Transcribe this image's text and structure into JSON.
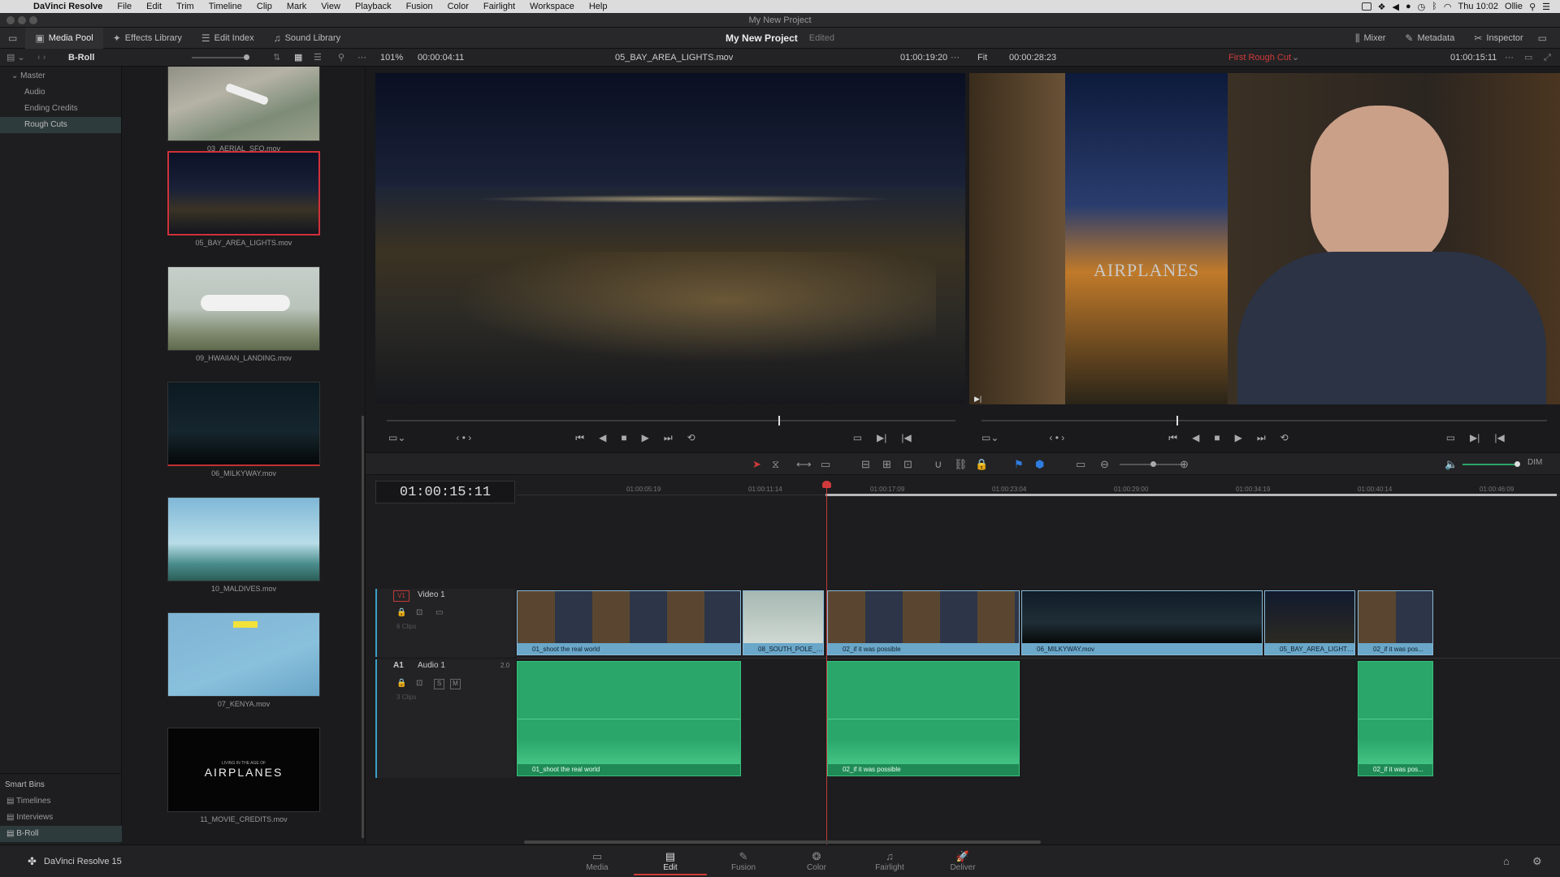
{
  "menubar": {
    "app": "DaVinci Resolve",
    "items": [
      "File",
      "Edit",
      "Trim",
      "Timeline",
      "Clip",
      "Mark",
      "View",
      "Playback",
      "Fusion",
      "Color",
      "Fairlight",
      "Workspace",
      "Help"
    ],
    "clock": "Thu 10:02",
    "user": "Ollie"
  },
  "window_title": "My New Project",
  "toolbar": {
    "media_pool": "Media Pool",
    "effects_library": "Effects Library",
    "edit_index": "Edit Index",
    "sound_library": "Sound Library",
    "project_name": "My New Project",
    "project_status": "Edited",
    "mixer": "Mixer",
    "metadata": "Metadata",
    "inspector": "Inspector"
  },
  "subbar": {
    "bin": "B-Roll",
    "src_zoom": "101%",
    "src_duration": "00:00:04:11",
    "src_clip": "05_BAY_AREA_LIGHTS.mov",
    "src_timecode": "01:00:19:20",
    "prg_zoom": "Fit",
    "prg_duration": "00:00:28:23",
    "timeline_name": "First Rough Cut",
    "prg_timecode": "01:00:15:11"
  },
  "bins": {
    "master": "Master",
    "items": [
      "Audio",
      "Ending Credits",
      "Rough Cuts"
    ],
    "smart_bins_title": "Smart Bins",
    "smart_items": [
      "Timelines",
      "Interviews",
      "B-Roll"
    ]
  },
  "clips": [
    {
      "name": "03_AERIAL_SFO.mov"
    },
    {
      "name": "05_BAY_AREA_LIGHTS.mov"
    },
    {
      "name": "09_HWAIIAN_LANDING.mov"
    },
    {
      "name": "06_MILKYWAY.mov"
    },
    {
      "name": "10_MALDIVES.mov"
    },
    {
      "name": "07_KENYA.mov"
    },
    {
      "name": "11_MOVIE_CREDITS.mov"
    }
  ],
  "credits_thumb": {
    "small": "LIVING IN THE AGE OF",
    "big": "AIRPLANES"
  },
  "poster_text": "AIRPLANES",
  "timeline": {
    "timecode": "01:00:15:11",
    "ruler": [
      "01:00:05:19",
      "01:00:11:14",
      "01:00:17:09",
      "01:00:23:04",
      "01:00:29:00",
      "01:00:34:19",
      "01:00:40:14",
      "01:00:46:09"
    ],
    "video_track": {
      "id": "V1",
      "name": "Video 1",
      "count": "6 Clips"
    },
    "audio_track": {
      "id": "A1",
      "name": "Audio 1",
      "channels": "2.0",
      "count": "3 Clips",
      "solo": "S",
      "mute": "M"
    },
    "video_clips": [
      "01_shoot the real world",
      "08_SOUTH_POLE_DC3_...",
      "02_if it was possible",
      "06_MILKYWAY.mov",
      "05_BAY_AREA_LIGHTS.mov",
      "02_if it was pos..."
    ],
    "audio_clips": [
      "01_shoot the real world",
      "02_if it was possible",
      "02_if it was pos..."
    ]
  },
  "bottom": {
    "brand": "DaVinci Resolve 15",
    "pages": [
      "Media",
      "Edit",
      "Fusion",
      "Color",
      "Fairlight",
      "Deliver"
    ],
    "active_page": "Edit"
  },
  "colors": {
    "accent_red": "#d03a3a",
    "clip_blue": "#6aa7c9",
    "clip_green": "#2aa66a"
  }
}
